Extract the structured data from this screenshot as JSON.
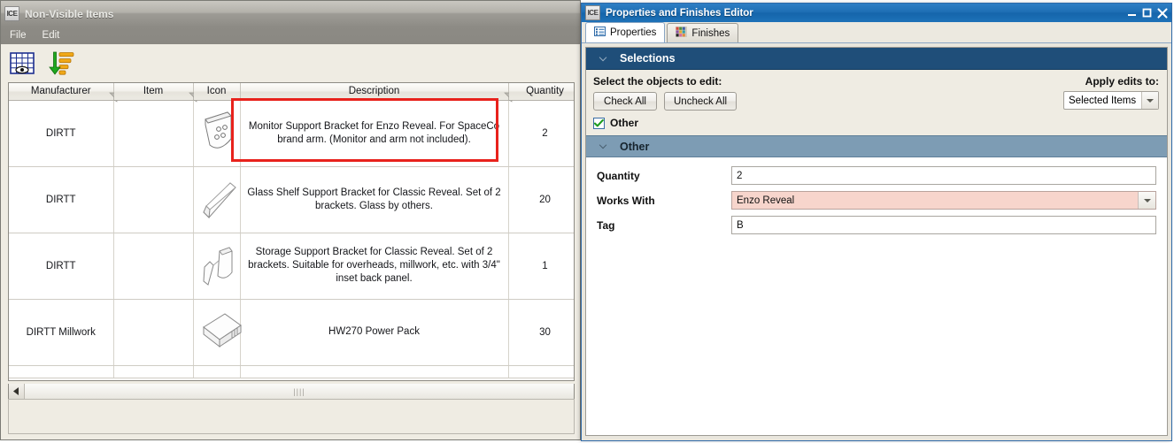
{
  "nonvisible_window": {
    "app_icon_text": "ICE",
    "title": "Non-Visible Items",
    "menu": [
      {
        "label": "File"
      },
      {
        "label": "Edit"
      }
    ],
    "toolbar": [
      {
        "name": "show-non-visible-items-icon",
        "tooltip": "Non-Visible Items"
      },
      {
        "name": "sort-descending-icon",
        "tooltip": "Sort"
      }
    ],
    "table": {
      "columns": [
        {
          "label": "Manufacturer",
          "filter": true
        },
        {
          "label": "Item",
          "filter": true
        },
        {
          "label": "Icon",
          "filter": false
        },
        {
          "label": "Description",
          "filter": true
        },
        {
          "label": "Quantity",
          "filter": true
        }
      ],
      "rows": [
        {
          "manufacturer": "DIRTT",
          "item": "",
          "icon": "monitor-support-bracket-icon",
          "description": "Monitor Support Bracket for Enzo Reveal. For SpaceCo brand arm. (Monitor and arm not included).",
          "quantity": "2",
          "highlighted": true
        },
        {
          "manufacturer": "DIRTT",
          "item": "",
          "icon": "glass-shelf-support-bracket-icon",
          "description": "Glass Shelf Support Bracket for Classic Reveal. Set of 2 brackets. Glass by others.",
          "quantity": "20",
          "highlighted": false
        },
        {
          "manufacturer": "DIRTT",
          "item": "",
          "icon": "storage-support-bracket-icon",
          "description": "Storage Support Bracket for Classic Reveal. Set of 2 brackets. Suitable for overheads, millwork, etc. with 3/4\" inset back panel.",
          "quantity": "1",
          "highlighted": false
        },
        {
          "manufacturer": "DIRTT Millwork",
          "item": "",
          "icon": "power-pack-icon",
          "description": "HW270 Power Pack",
          "quantity": "30",
          "highlighted": false
        }
      ]
    },
    "highlight_color": "#e8221c"
  },
  "properties_editor": {
    "app_icon_text": "ICE",
    "title": "Properties and Finishes Editor",
    "window_buttons": [
      {
        "name": "minimize-button",
        "label": "–"
      },
      {
        "name": "maximize-button",
        "label": "☐"
      },
      {
        "name": "close-button",
        "label": "✕"
      }
    ],
    "tabs": [
      {
        "label": "Properties",
        "icon": "list-icon",
        "active": true
      },
      {
        "label": "Finishes",
        "icon": "color-swatches-icon",
        "active": false
      }
    ],
    "selections": {
      "header": "Selections",
      "prompt": "Select the objects to edit:",
      "check_all_label": "Check All",
      "uncheck_all_label": "Uncheck All",
      "checkbox": {
        "label": "Other",
        "checked": true
      },
      "apply_edits_label": "Apply edits to:",
      "apply_edits_value": "Selected Items",
      "apply_edits_options": [
        "Selected Items"
      ]
    },
    "other_section": {
      "header": "Other",
      "fields": [
        {
          "label": "Quantity",
          "value": "2",
          "type": "text"
        },
        {
          "label": "Works With",
          "value": "Enzo Reveal",
          "type": "combo",
          "highlighted": true
        },
        {
          "label": "Tag",
          "value": "B",
          "type": "text"
        }
      ]
    },
    "accent_colors": {
      "titlebar": "#1f6fb5",
      "selections_header": "#1f4e79",
      "other_header": "#7d9cb4",
      "modified_field": "#f7d5cc"
    }
  }
}
